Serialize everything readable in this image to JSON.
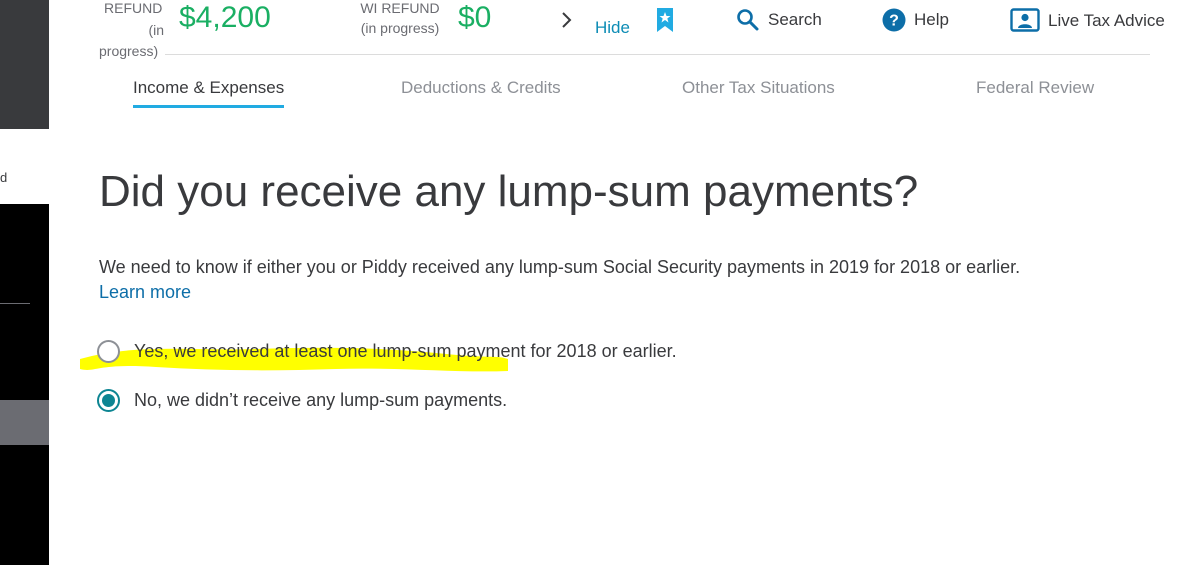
{
  "header": {
    "federal_refund": {
      "label_line1": "REFUND",
      "label_line2": "(in",
      "label_line3": "progress)",
      "amount": "$4,200"
    },
    "state_refund": {
      "label_line1": "WI REFUND",
      "label_line2": "(in progress)",
      "amount": "$0"
    },
    "hide_label": "Hide",
    "search_label": "Search",
    "help_label": "Help",
    "live_advice_label": "Live Tax Advice"
  },
  "sidebar": {
    "partial_text": "d"
  },
  "tabs": [
    {
      "label": "Income & Expenses",
      "active": true
    },
    {
      "label": "Deductions & Credits",
      "active": false
    },
    {
      "label": "Other Tax Situations",
      "active": false
    },
    {
      "label": "Federal Review",
      "active": false
    }
  ],
  "main": {
    "question": "Did you receive any lump-sum payments?",
    "description": "We need to know if either you or Piddy received any lump-sum Social Security payments in 2019 for 2018 or earlier.",
    "learn_more": "Learn more",
    "options": [
      {
        "label": "Yes, we received at least one lump-sum payment for 2018 or earlier.",
        "selected": false
      },
      {
        "label": "No, we didn’t receive any lump-sum payments.",
        "selected": true
      }
    ]
  },
  "colors": {
    "refund_green": "#1aaf63",
    "link_blue": "#0d8cb5",
    "active_tab_underline": "#21abe2",
    "radio_teal": "#0d8592",
    "highlight_yellow": "#ffff00"
  },
  "icons": [
    "chevron-right-icon",
    "bookmark-star-icon",
    "search-icon",
    "help-icon",
    "live-advice-icon"
  ]
}
